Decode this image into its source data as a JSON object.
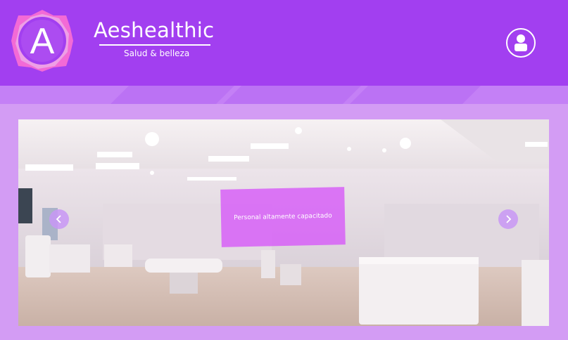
{
  "brand": {
    "name": "Aeshealthic",
    "tagline": "Salud & belleza",
    "logo_letter": "A"
  },
  "header": {
    "user_icon": "user-icon"
  },
  "slider": {
    "caption": "Personal altamente capacitado",
    "prev_icon": "chevron-left-icon",
    "next_icon": "chevron-right-icon"
  },
  "colors": {
    "header": "#a23ff0",
    "stripe": "#c480f6",
    "background": "#d39cf4",
    "caption": "#d656f8"
  }
}
